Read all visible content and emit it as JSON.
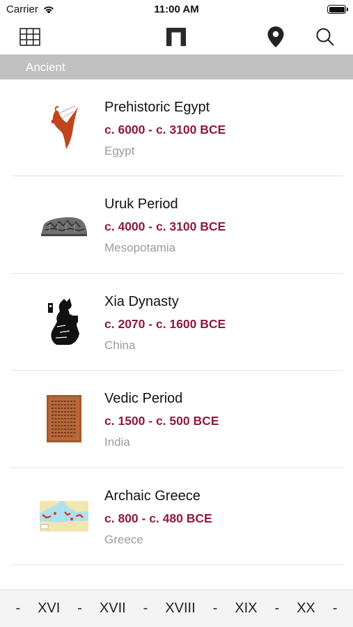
{
  "status": {
    "carrier": "Carrier",
    "time": "11:00 AM",
    "battery_level": 1.0
  },
  "nav": {
    "icons": [
      "grid-icon",
      "pantheon-logo",
      "location-pin-icon",
      "search-icon"
    ]
  },
  "section": {
    "title": "Ancient"
  },
  "periods": [
    {
      "title": "Prehistoric Egypt",
      "dates": "c. 6000 - c. 3100 BCE",
      "region": "Egypt",
      "image": "egyptian-figure-thumbnail"
    },
    {
      "title": "Uruk Period",
      "dates": "c. 4000 - c. 3100 BCE",
      "region": "Mesopotamia",
      "image": "carved-relief-thumbnail"
    },
    {
      "title": "Xia Dynasty",
      "dates": "c. 2070 - c. 1600 BCE",
      "region": "China",
      "image": "figure-drawing-thumbnail"
    },
    {
      "title": "Vedic Period",
      "dates": "c. 1500 - c. 500 BCE",
      "region": "India",
      "image": "manuscript-thumbnail"
    },
    {
      "title": "Archaic Greece",
      "dates": "c. 800 - c. 480 BCE",
      "region": "Greece",
      "image": "map-thumbnail"
    }
  ],
  "centuries": {
    "sep": "-",
    "labels": [
      "XVI",
      "XVII",
      "XVIII",
      "XIX",
      "XX"
    ]
  }
}
